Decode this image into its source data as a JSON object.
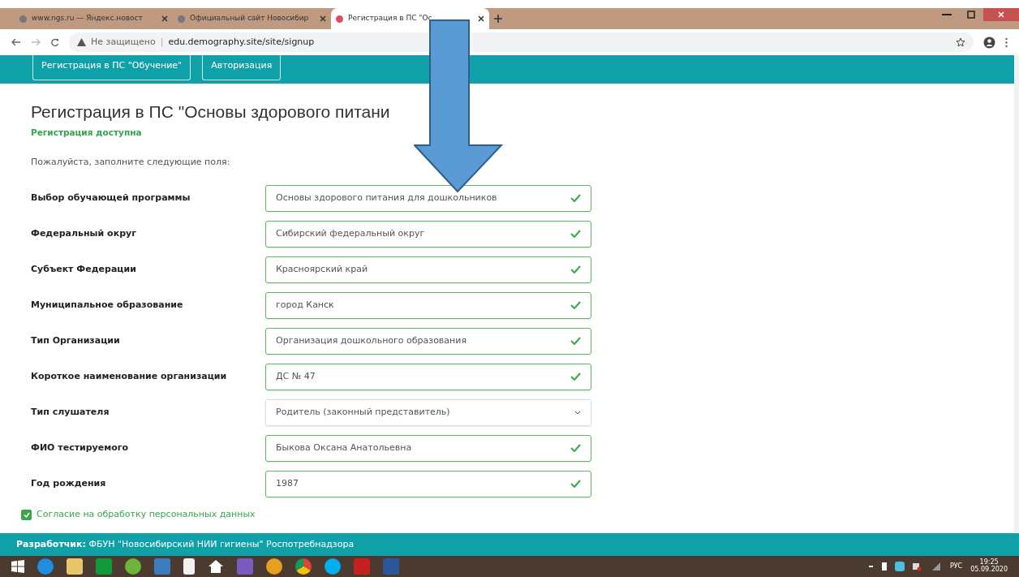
{
  "browser": {
    "tabs": [
      {
        "title": "www.ngs.ru — Яндекс.новост",
        "selected": false
      },
      {
        "title": "Официальный сайт Новосибир",
        "selected": false
      },
      {
        "title": "Регистрация в ПС \"Ос",
        "selected": true
      }
    ],
    "security": "Не защищено",
    "separator": "|",
    "url": "edu.demography.site/site/signup"
  },
  "navbar": {
    "buttons": [
      "Регистрация в ПС \"Обучение\"",
      "Авторизация"
    ]
  },
  "heading": "Регистрация в ПС \"Основы здорового питани",
  "status": "Регистрация доступна",
  "intro": "Пожалуйста, заполните следующие поля:",
  "fields": [
    {
      "label": "Выбор обучающей программы",
      "kind": "text",
      "value": "Основы здорового питания для дошкольников",
      "valid": true
    },
    {
      "label": "Федеральный округ",
      "kind": "text",
      "value": "Сибирский федеральный округ",
      "valid": true
    },
    {
      "label": "Субъект Федерации",
      "kind": "text",
      "value": "Красноярский край",
      "valid": true
    },
    {
      "label": "Муниципальное образование",
      "kind": "text",
      "value": "город Канск",
      "valid": true
    },
    {
      "label": "Тип Организации",
      "kind": "text",
      "value": "Организация дошкольного образования",
      "valid": true
    },
    {
      "label": "Короткое наименование организации",
      "kind": "text",
      "value": "ДС № 47",
      "valid": true
    },
    {
      "label": "Тип слушателя",
      "kind": "select",
      "value": "Родитель (законный представитель)",
      "valid": false
    },
    {
      "label": "ФИО тестируемого",
      "kind": "text",
      "value": "Быкова Оксана Анатольевна",
      "valid": true
    },
    {
      "label": "Год рождения",
      "kind": "text",
      "value": "1987",
      "valid": true
    }
  ],
  "consent": {
    "label": "Согласие на обработку персональных данных",
    "checked": true
  },
  "footer": {
    "label": "Разработчик:",
    "text": "ФБУН \"Новосибирский НИИ гигиены\" Роспотребнадзора"
  },
  "taskbar": {
    "language": "РУС",
    "time": "19:25",
    "date": "05.09.2020"
  }
}
